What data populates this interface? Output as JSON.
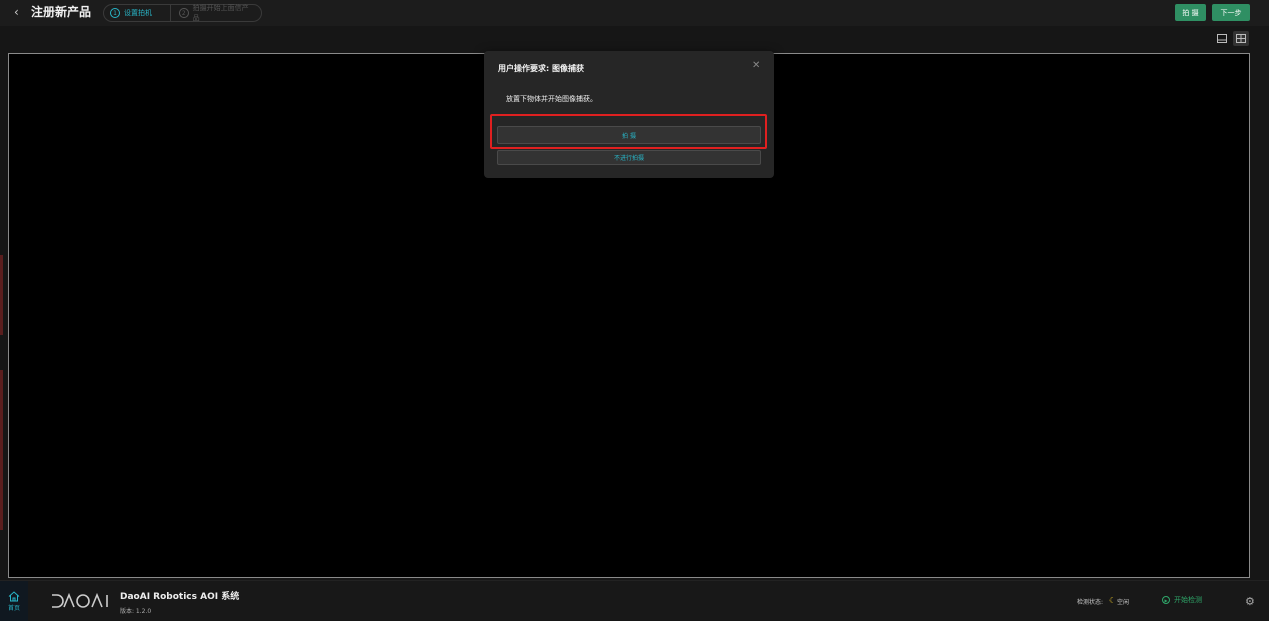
{
  "header": {
    "back_icon": "chevron-left-icon",
    "title": "注册新产品",
    "steps": [
      {
        "num": "1",
        "label": "设置拍机"
      },
      {
        "num": "2",
        "label": "拍摄开始上面信产品"
      }
    ],
    "capture_label": "拍 摄",
    "next_label": "下一步",
    "accent_color": "#2f8f63",
    "step_active_color": "#29b6c8"
  },
  "view_toggle": {
    "single_icon": "single-view-icon",
    "grid_icon": "grid-view-icon"
  },
  "dialog": {
    "title": "用户操作要求: 图像捕获",
    "close_icon": "close-icon",
    "message": "放置下物体并开始图像捕获。",
    "capture_button": "拍 摄",
    "skip_button": "不进行拍摄"
  },
  "footer": {
    "home_icon": "home-icon",
    "home_label": "首页",
    "logo": "DAOAI",
    "app_name": "DaoAI Robotics AOI 系统",
    "version": "版本: 1.2.0",
    "status_label": "检测状态:",
    "status_icon": "moon-icon",
    "status_value": "空闲",
    "start_label": "开始检测",
    "settings_icon": "gear-icon"
  }
}
